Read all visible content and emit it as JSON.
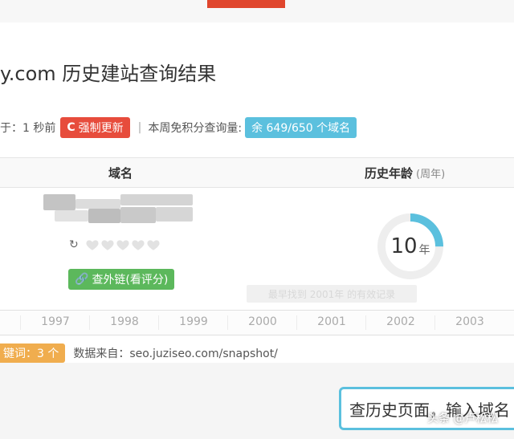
{
  "header": {
    "title": "y.com 历史建站查询结果"
  },
  "info_bar": {
    "updated_text": "于：1 秒前",
    "refresh_label": "强制更新",
    "separator": "|",
    "quota_label": "本周免积分查询量:",
    "quota_badge": "余 649/650 个域名"
  },
  "table": {
    "col_domain": "域名",
    "col_age": "历史年龄",
    "col_age_unit": "(周年)"
  },
  "row": {
    "links_button": "查外链(看评分)",
    "age_value": "10",
    "age_unit": "年",
    "age_ring_fill": 0.25,
    "tooltip": "最早找到 2001年 的有效记录",
    "rating_hearts": 5
  },
  "timeline": {
    "years": [
      "1997",
      "1998",
      "1999",
      "2000",
      "2001",
      "2002",
      "2003"
    ]
  },
  "footer": {
    "keyword_badge": "键词：3 个",
    "source_text": "数据来自：seo.juziseo.com/snapshot/"
  },
  "search": {
    "text": "查历史页面，输入域名"
  },
  "watermark": "头条 @卢松松",
  "colors": {
    "accent_red": "#e74c3c",
    "accent_blue": "#5bc0de",
    "accent_green": "#5cb85c",
    "accent_orange": "#f0ad4e"
  }
}
